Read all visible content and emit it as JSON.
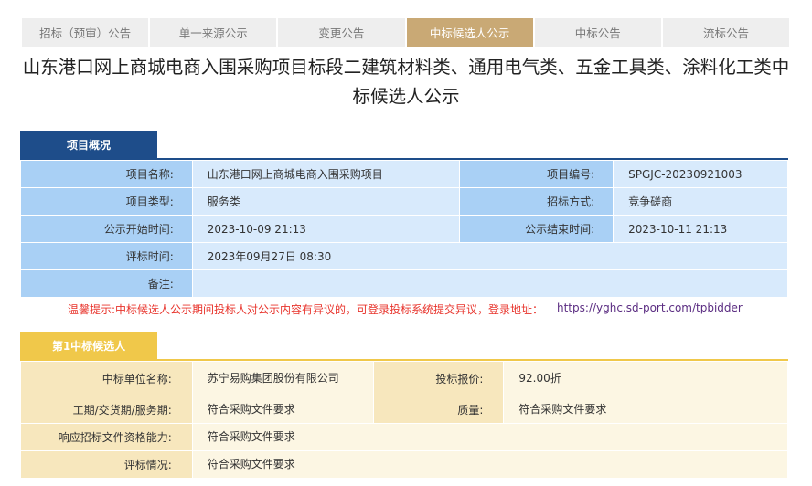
{
  "tabs": [
    {
      "label": "招标（预审）公告",
      "active": false
    },
    {
      "label": "单一来源公示",
      "active": false
    },
    {
      "label": "变更公告",
      "active": false
    },
    {
      "label": "中标候选人公示",
      "active": true
    },
    {
      "label": "中标公告",
      "active": false
    },
    {
      "label": "流标公告",
      "active": false
    }
  ],
  "title": "山东港口网上商城电商入围采购项目标段二建筑材料类、通用电气类、五金工具类、涂料化工类中标候选人公示",
  "project": {
    "section_title": "项目概况",
    "name_label": "项目名称:",
    "name_value": "山东港口网上商城电商入围采购项目",
    "code_label": "项目编号:",
    "code_value": "SPGJC-20230921003",
    "type_label": "项目类型:",
    "type_value": "服务类",
    "method_label": "招标方式:",
    "method_value": "竞争磋商",
    "start_label": "公示开始时间:",
    "start_value": "2023-10-09 21:13",
    "end_label": "公示结束时间:",
    "end_value": "2023-10-11 21:13",
    "eval_time_label": "评标时间:",
    "eval_time_value": "2023年09月27日 08:30",
    "remark_label": "备注:",
    "remark_value": ""
  },
  "notice": {
    "text": "温馨提示:中标候选人公示期间投标人对公示内容有异议的，可登录投标系统提交异议，登录地址：",
    "link": "https://yghc.sd-port.com/tpbidder"
  },
  "candidate": {
    "section_title": "第1中标候选人",
    "unit_label": "中标单位名称:",
    "unit_value": "苏宁易购集团股份有限公司",
    "price_label": "投标报价:",
    "price_value": "92.00折",
    "period_label": "工期/交货期/服务期:",
    "period_value": "符合采购文件要求",
    "quality_label": "质量:",
    "quality_value": "符合采购文件要求",
    "ability_label": "响应招标文件资格能力:",
    "ability_value": "符合采购文件要求",
    "eval_label": "评标情况:",
    "eval_value": "符合采购文件要求"
  },
  "colors": {
    "active_tab": "#c9a975",
    "blue_header": "#1e4d8a",
    "gold_header": "#f0c84a",
    "notice_red": "#e8342c"
  }
}
